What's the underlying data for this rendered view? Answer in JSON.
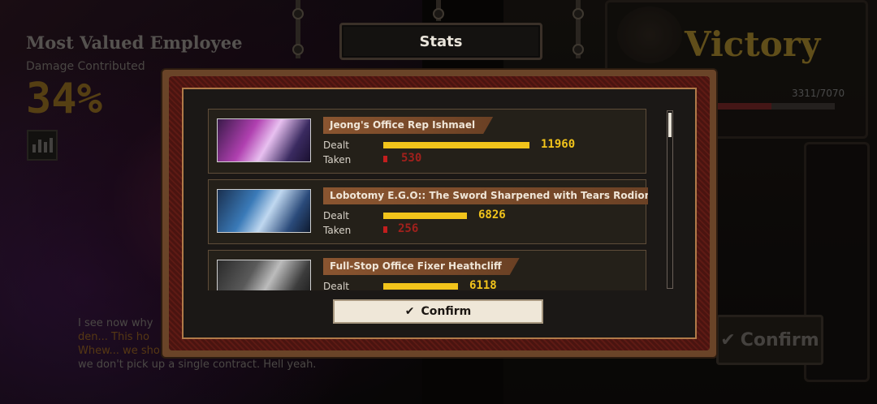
{
  "background": {
    "mve_title": "Most Valued Employee",
    "damage_label": "Damage Contributed",
    "damage_percent": "34%",
    "victory": "Victory",
    "hp_text": "3311/7070",
    "hp_fraction": 0.47,
    "dialogue": [
      "I see now why",
      "den... This ho",
      "Whew... we sho",
      "we don't pick up a single contract. Hell yeah."
    ],
    "confirm_label": "Confirm"
  },
  "modal": {
    "tab_title": "Stats",
    "dealt_label": "Dealt",
    "taken_label": "Taken",
    "confirm_label": "Confirm",
    "entries": [
      {
        "name": "Jeong's Office Rep Ishmael",
        "dealt": "11960",
        "taken": "530",
        "dealt_value": 11960,
        "taken_value": 530
      },
      {
        "name": "Lobotomy E.G.O:: The Sword Sharpened with Tears Rodion",
        "dealt": "6826",
        "taken": "256",
        "dealt_value": 6826,
        "taken_value": 256
      },
      {
        "name": "Full-Stop Office Fixer Heathcliff",
        "dealt": "6118",
        "taken": "",
        "dealt_value": 6118,
        "taken_value": null
      }
    ]
  },
  "icons": {
    "confirm": "check-icon",
    "chart": "bar-chart-icon"
  },
  "colors": {
    "dealt_bar": "#f2c41b",
    "taken_bar": "#c31e1e",
    "modal_border": "#b07a48",
    "victory_gold": "#9c7f2a"
  }
}
